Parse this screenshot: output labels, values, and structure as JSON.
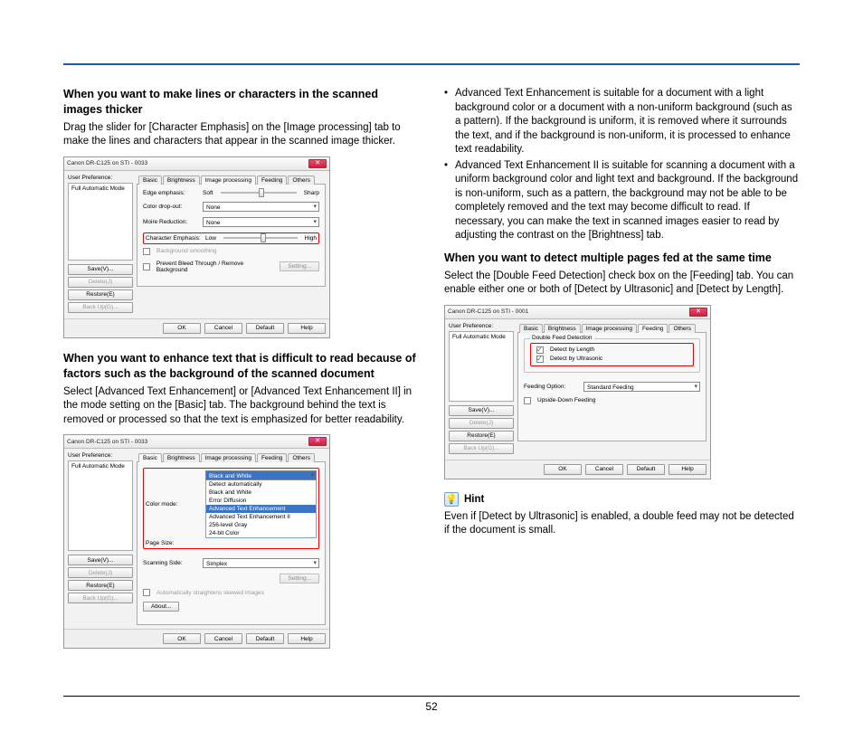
{
  "page_number": "52",
  "col1": {
    "h1": "When you want to make lines or characters in the scanned images thicker",
    "p1": "Drag the slider for [Character Emphasis] on the [Image processing] tab to make the lines and characters that appear in the scanned image thicker.",
    "h2": "When you want to enhance text that is difficult to read because of factors such as the background of the scanned document",
    "p2": "Select [Advanced Text Enhancement] or [Advanced Text Enhancement II] in the mode setting on the [Basic] tab. The background behind the text is removed or processed so that the text is emphasized for better readability."
  },
  "col2": {
    "b1": "Advanced Text Enhancement is suitable for a document with a light background color or a document with a non-uniform background (such as a pattern). If the background is uniform, it is removed where it surrounds the text, and if the background is non-uniform, it is processed to enhance text readability.",
    "b2": "Advanced Text Enhancement II is suitable for scanning a document with a uniform background color and light text and background. If the background is non-uniform, such as a pattern, the background may not be able to be completely removed and the text may become difficult to read. If necessary, you can make the text in scanned images easier to read by adjusting the contrast on the [Brightness] tab.",
    "h3": "When you want to detect multiple pages fed at the same time",
    "p3": "Select the [Double Feed Detection] check box on the [Feeding] tab. You can enable either one or both of [Detect by Ultrasonic] and [Detect by Length].",
    "hint_label": "Hint",
    "hint_text": "Even if [Detect by Ultrasonic] is enabled, a double feed may not be detected if the document is small."
  },
  "dlg": {
    "title": "Canon DR-C125 on STI - 0033",
    "title2": "Canon DR-C125 on STI - 0001",
    "user_pref": "User Preference:",
    "mode": "Full Automatic Mode",
    "save": "Save(V)...",
    "delete": "Delete(J)",
    "restore": "Restore(E)",
    "backup": "Back Up(G)...",
    "tabs": [
      "Basic",
      "Brightness",
      "Image processing",
      "Feeding",
      "Others"
    ],
    "ok": "OK",
    "cancel": "Cancel",
    "default": "Default",
    "help": "Help",
    "edge": "Edge emphasis:",
    "soft": "Soft",
    "sharp": "Sharp",
    "color_dropout": "Color drop-out:",
    "none": "None",
    "moire": "Moire Reduction:",
    "char_emph": "Character Emphasis:",
    "low": "Low",
    "high": "High",
    "bgsmooth": "Background smoothing",
    "prevent": "Prevent Bleed Through / Remove Background",
    "setting": "Setting...",
    "color_mode": "Color mode:",
    "page_size": "Page Size:",
    "scanning_side": "Scanning Side:",
    "simplex": "Simplex",
    "auto_straight": "Automatically straightens skewed images",
    "about": "About...",
    "dd_items": [
      "Black and White",
      "Detect automatically",
      "Black and White",
      "Error Diffusion",
      "Advanced Text Enhancement",
      "Advanced Text Enhancement II",
      "256-level Gray",
      "24-bit Color"
    ],
    "dfd": "Double Feed Detection",
    "dby_len": "Detect by Length",
    "dby_us": "Detect by Ultrasonic",
    "feed_opt": "Feeding Option:",
    "std_feed": "Standard Feeding",
    "upside": "Upside-Down Feeding"
  }
}
